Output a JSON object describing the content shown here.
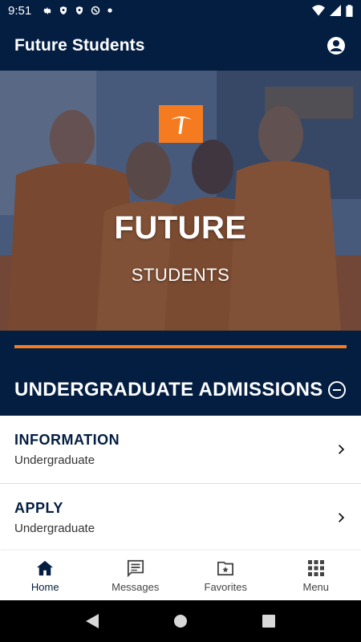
{
  "status_bar": {
    "time": "9:51",
    "icons": [
      "gear-icon",
      "shield-icon",
      "shield-icon",
      "at-sign-icon",
      "dot-icon"
    ],
    "right_icons": [
      "wifi-icon",
      "signal-icon",
      "battery-icon"
    ]
  },
  "app_bar": {
    "title": "Future Students",
    "account_icon": "account-circle-icon"
  },
  "hero": {
    "title": "FUTURE",
    "subtitle": "STUDENTS",
    "logo_icon": "pickaxe-logo-icon"
  },
  "section": {
    "title": "UNDERGRADUATE ADMISSIONS",
    "toggle_icon": "minus-circle-icon"
  },
  "list": [
    {
      "title": "INFORMATION",
      "subtitle": "Undergraduate"
    },
    {
      "title": "APPLY",
      "subtitle": "Undergraduate"
    }
  ],
  "bottom_nav": [
    {
      "label": "Home",
      "icon": "home-icon",
      "active": true
    },
    {
      "label": "Messages",
      "icon": "message-icon",
      "active": false
    },
    {
      "label": "Favorites",
      "icon": "folder-star-icon",
      "active": false
    },
    {
      "label": "Menu",
      "icon": "grid-icon",
      "active": false
    }
  ],
  "colors": {
    "navy": "#041e42",
    "orange": "#f47b20"
  }
}
